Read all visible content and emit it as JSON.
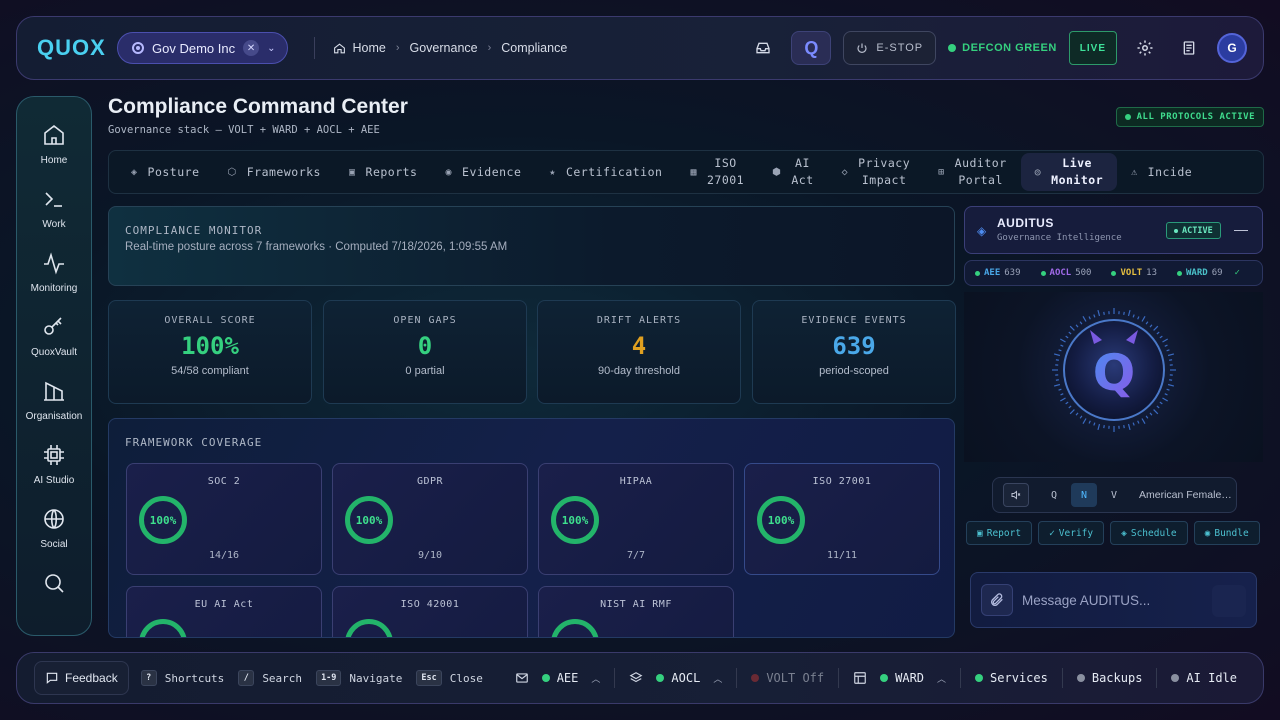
{
  "app": {
    "logo": "QUOX",
    "org": "Gov Demo Inc"
  },
  "breadcrumbs": [
    "Home",
    "Governance",
    "Compliance"
  ],
  "topbar": {
    "estop_label": "E-STOP",
    "defcon_label": "DEFCON GREEN",
    "live_label": "LIVE",
    "avatar_initial": "G",
    "q_badge": "Q"
  },
  "sidebar": {
    "items": [
      {
        "label": "Home",
        "icon": "home-icon"
      },
      {
        "label": "Work",
        "icon": "terminal-icon"
      },
      {
        "label": "Monitoring",
        "icon": "pulse-icon"
      },
      {
        "label": "QuoxVault",
        "icon": "key-icon"
      },
      {
        "label": "Organisation",
        "icon": "building-icon"
      },
      {
        "label": "AI Studio",
        "icon": "chip-icon"
      },
      {
        "label": "Social",
        "icon": "globe-icon"
      }
    ]
  },
  "page": {
    "title": "Compliance Command Center",
    "subtitle": "Governance stack — VOLT + WARD + AOCL + AEE",
    "protocols_badge": "ALL PROTOCOLS ACTIVE"
  },
  "tabs": [
    {
      "icon": "◈",
      "label": "Posture"
    },
    {
      "icon": "⬡",
      "label": "Frameworks"
    },
    {
      "icon": "▣",
      "label": "Reports"
    },
    {
      "icon": "◉",
      "label": "Evidence"
    },
    {
      "icon": "★",
      "label": "Certification"
    },
    {
      "icon": "▦",
      "label": "ISO\n27001"
    },
    {
      "icon": "⬢",
      "label": "AI\nAct"
    },
    {
      "icon": "◇",
      "label": "Privacy\nImpact"
    },
    {
      "icon": "⊞",
      "label": "Auditor\nPortal"
    },
    {
      "icon": "◎",
      "label": "Live\nMonitor",
      "active": true
    },
    {
      "icon": "⚠",
      "label": "Incide"
    }
  ],
  "monitor": {
    "heading": "COMPLIANCE MONITOR",
    "description": "Real-time posture across 7 frameworks · Computed 7/18/2026, 1:09:55 AM"
  },
  "stats": [
    {
      "label": "OVERALL SCORE",
      "value": "100%",
      "sub": "54/58 compliant",
      "color": "#35d07f"
    },
    {
      "label": "OPEN GAPS",
      "value": "0",
      "sub": "0 partial",
      "color": "#35d07f"
    },
    {
      "label": "DRIFT ALERTS",
      "value": "4",
      "sub": "90-day threshold",
      "color": "#e0a020"
    },
    {
      "label": "EVIDENCE EVENTS",
      "value": "639",
      "sub": "period-scoped",
      "color": "#4aa8e8"
    }
  ],
  "coverage": {
    "heading": "FRAMEWORK COVERAGE",
    "frameworks": [
      {
        "name": "SOC 2",
        "pct": "100%",
        "count": "14/16"
      },
      {
        "name": "GDPR",
        "pct": "100%",
        "count": "9/10"
      },
      {
        "name": "HIPAA",
        "pct": "100%",
        "count": "7/7"
      },
      {
        "name": "ISO 27001",
        "pct": "100%",
        "count": "11/11"
      },
      {
        "name": "EU AI Act",
        "pct": "",
        "count": ""
      },
      {
        "name": "ISO 42001",
        "pct": "",
        "count": ""
      },
      {
        "name": "NIST AI RMF",
        "pct": "",
        "count": ""
      }
    ]
  },
  "auditus": {
    "title": "AUDITUS",
    "subtitle": "Governance Intelligence",
    "status": "ACTIVE",
    "minimize": "—",
    "chips": [
      {
        "name": "AEE",
        "count": "639",
        "color": "#4aa8e8"
      },
      {
        "name": "AOCL",
        "count": "500",
        "color": "#a06ae8"
      },
      {
        "name": "VOLT",
        "count": "13",
        "color": "#e8c040"
      },
      {
        "name": "WARD",
        "count": "69",
        "color": "#4ac0c8"
      }
    ],
    "chip_check": "✓",
    "voice_modes": [
      "Q",
      "N",
      "V"
    ],
    "voice_selected": "N",
    "voice_name": "American Female…",
    "actions": [
      {
        "icon": "▣",
        "label": "Report"
      },
      {
        "icon": "✓",
        "label": "Verify"
      },
      {
        "icon": "◈",
        "label": "Schedule"
      },
      {
        "icon": "◉",
        "label": "Bundle"
      }
    ],
    "message_placeholder": "Message AUDITUS..."
  },
  "bottombar": {
    "feedback": "Feedback",
    "shortcuts": [
      {
        "key": "?",
        "label": "Shortcuts"
      },
      {
        "key": "/",
        "label": "Search"
      },
      {
        "key": "1-9",
        "label": "Navigate"
      },
      {
        "key": "Esc",
        "label": "Close"
      }
    ],
    "services": [
      {
        "name": "AEE",
        "status_color": "#35d07f",
        "icon": "mail-icon",
        "caret": true
      },
      {
        "name": "AOCL",
        "status_color": "#35d07f",
        "icon": "layers-icon",
        "caret": true
      },
      {
        "name": "VOLT Off",
        "status_color": "#6a2a34",
        "icon": "",
        "caret": false,
        "muted": true
      },
      {
        "name": "WARD",
        "status_color": "#35d07f",
        "icon": "layout-icon",
        "caret": true
      },
      {
        "name": "Services",
        "status_color": "#35d07f",
        "icon": "",
        "caret": false
      },
      {
        "name": "Backups",
        "status_color": "#8a90a0",
        "icon": "",
        "caret": false
      },
      {
        "name": "AI Idle",
        "status_color": "#8a90a0",
        "icon": "",
        "caret": false
      }
    ]
  },
  "colors": {
    "accent": "#4ad0f0",
    "success": "#35d07f",
    "warning": "#e0a020",
    "info": "#4aa8e8"
  }
}
